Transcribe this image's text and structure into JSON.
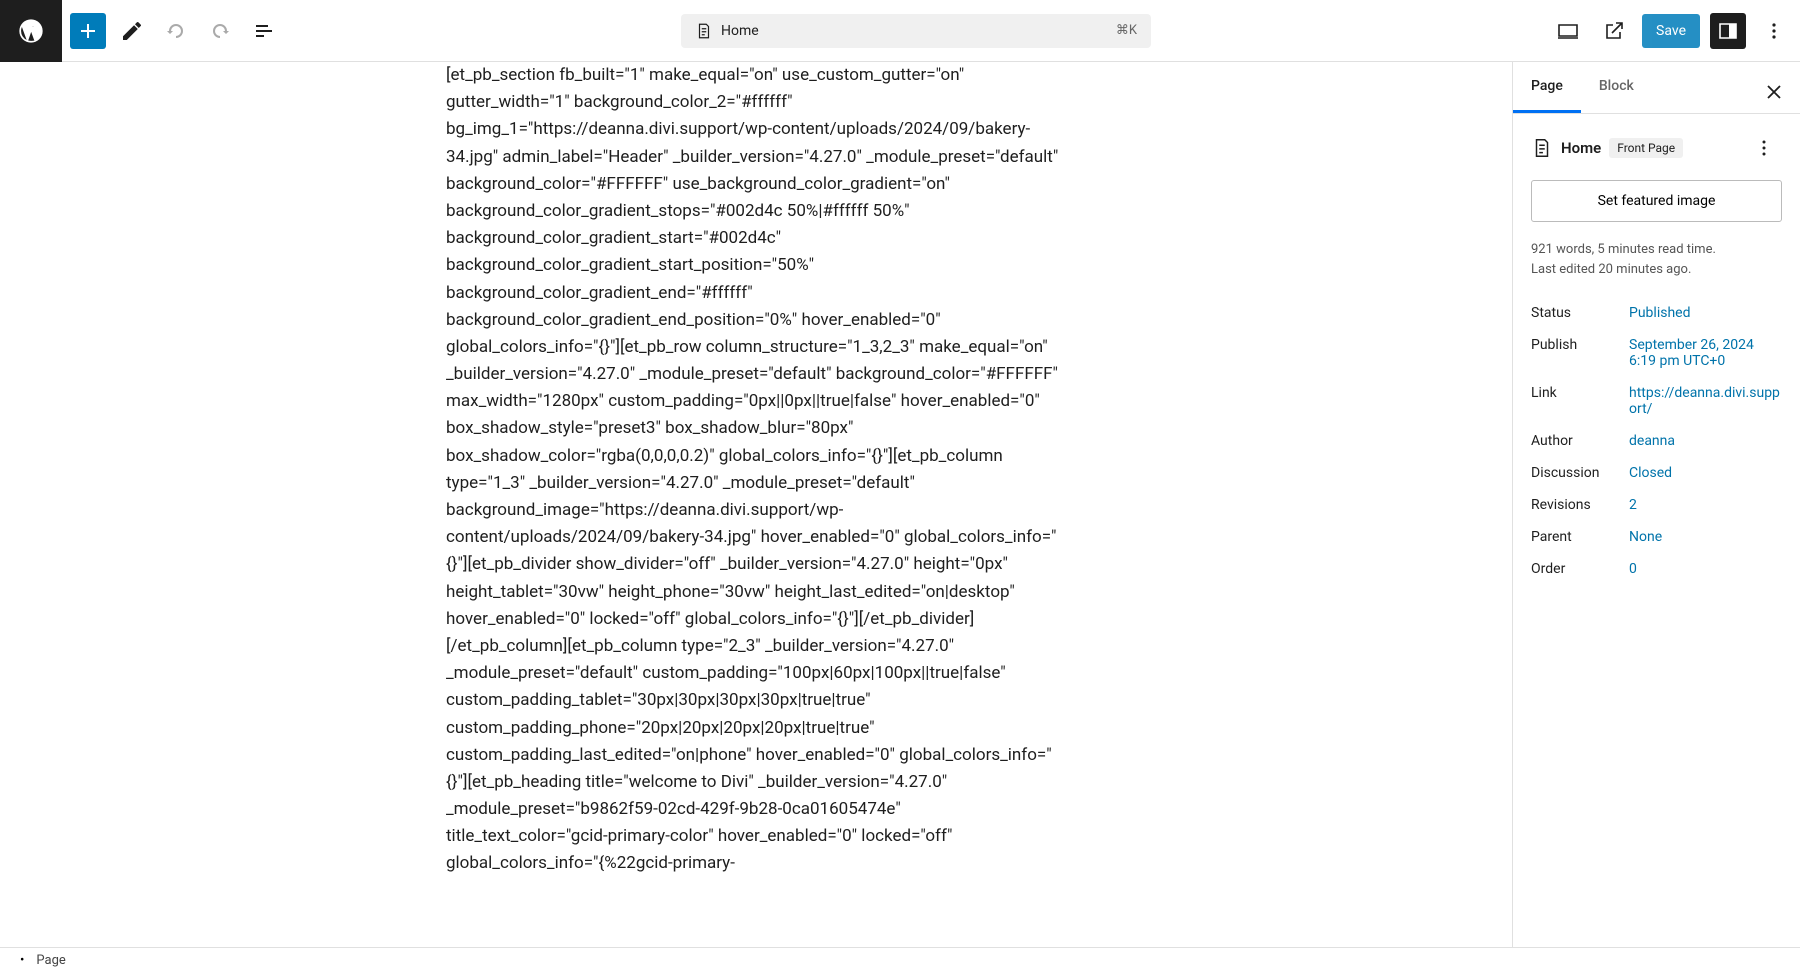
{
  "header": {
    "center_label": "Home",
    "shortcut": "⌘K",
    "save_label": "Save"
  },
  "editor": {
    "content": "[et_pb_section fb_built=\"1\" make_equal=\"on\" use_custom_gutter=\"on\" gutter_width=\"1\" background_color_2=\"#ffffff\" bg_img_1=\"https://deanna.divi.support/wp-content/uploads/2024/09/bakery-34.jpg\" admin_label=\"Header\" _builder_version=\"4.27.0\" _module_preset=\"default\" background_color=\"#FFFFFF\" use_background_color_gradient=\"on\" background_color_gradient_stops=\"#002d4c 50%|#ffffff 50%\" background_color_gradient_start=\"#002d4c\" background_color_gradient_start_position=\"50%\" background_color_gradient_end=\"#ffffff\" background_color_gradient_end_position=\"0%\" hover_enabled=\"0\" global_colors_info=\"{}\"][et_pb_row column_structure=\"1_3,2_3\" make_equal=\"on\" _builder_version=\"4.27.0\" _module_preset=\"default\" background_color=\"#FFFFFF\" max_width=\"1280px\" custom_padding=\"0px||0px||true|false\" hover_enabled=\"0\" box_shadow_style=\"preset3\" box_shadow_blur=\"80px\" box_shadow_color=\"rgba(0,0,0,0.2)\" global_colors_info=\"{}\"][et_pb_column type=\"1_3\" _builder_version=\"4.27.0\" _module_preset=\"default\" background_image=\"https://deanna.divi.support/wp-content/uploads/2024/09/bakery-34.jpg\" hover_enabled=\"0\" global_colors_info=\"{}\"][et_pb_divider show_divider=\"off\" _builder_version=\"4.27.0\" height=\"0px\" height_tablet=\"30vw\" height_phone=\"30vw\" height_last_edited=\"on|desktop\" hover_enabled=\"0\" locked=\"off\" global_colors_info=\"{}\"][/et_pb_divider][/et_pb_column][et_pb_column type=\"2_3\" _builder_version=\"4.27.0\" _module_preset=\"default\" custom_padding=\"100px|60px|100px||true|false\" custom_padding_tablet=\"30px|30px|30px|30px|true|true\" custom_padding_phone=\"20px|20px|20px|20px|true|true\" custom_padding_last_edited=\"on|phone\" hover_enabled=\"0\" global_colors_info=\"{}\"][et_pb_heading title=\"welcome to Divi\" _builder_version=\"4.27.0\" _module_preset=\"b9862f59-02cd-429f-9b28-0ca01605474e\" title_text_color=\"gcid-primary-color\" hover_enabled=\"0\" locked=\"off\" global_colors_info=\"{%22gcid-primary-"
  },
  "sidebar": {
    "tabs": {
      "page": "Page",
      "block": "Block"
    },
    "page_title": "Home",
    "page_badge": "Front Page",
    "featured_image_btn": "Set featured image",
    "meta_line1": "921 words, 5 minutes read time.",
    "meta_line2": "Last edited 20 minutes ago.",
    "rows": {
      "status": {
        "label": "Status",
        "value": "Published"
      },
      "publish": {
        "label": "Publish",
        "value": "September 26, 2024 6:19 pm UTC+0"
      },
      "link": {
        "label": "Link",
        "value": "https://deanna.divi.support/"
      },
      "author": {
        "label": "Author",
        "value": "deanna"
      },
      "discussion": {
        "label": "Discussion",
        "value": "Closed"
      },
      "revisions": {
        "label": "Revisions",
        "value": "2"
      },
      "parent": {
        "label": "Parent",
        "value": "None"
      },
      "order": {
        "label": "Order",
        "value": "0"
      }
    }
  },
  "footer": {
    "breadcrumb": "Page"
  }
}
